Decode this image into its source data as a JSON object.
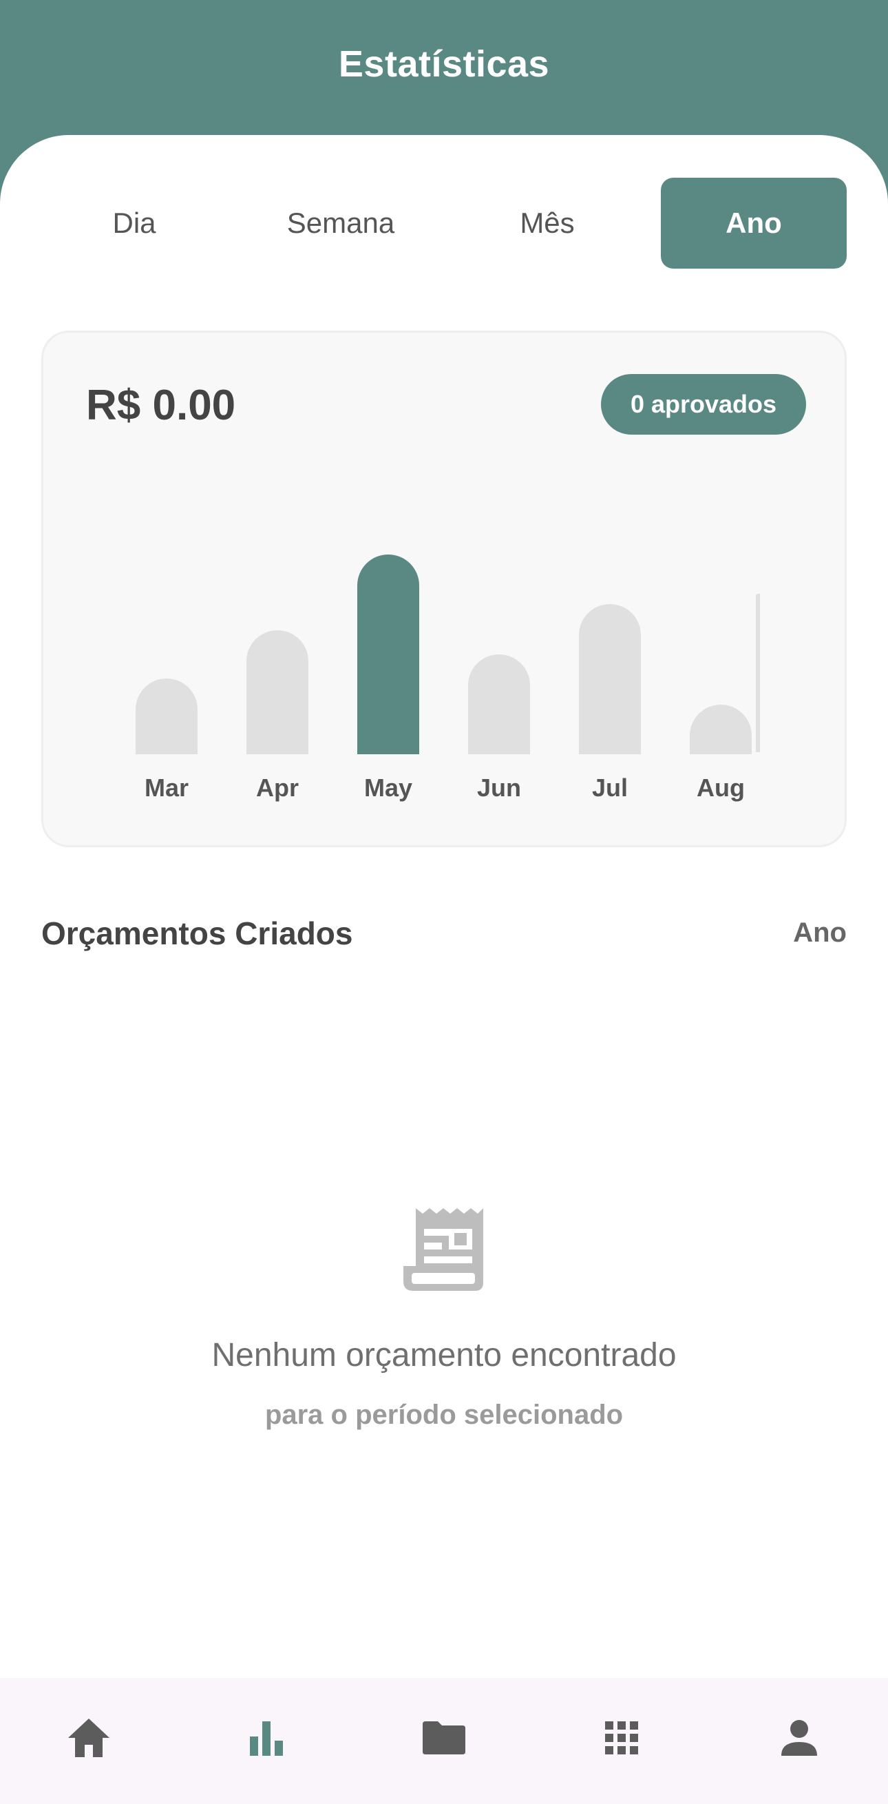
{
  "header": {
    "title": "Estatísticas"
  },
  "tabs": [
    {
      "label": "Dia",
      "active": false
    },
    {
      "label": "Semana",
      "active": false
    },
    {
      "label": "Mês",
      "active": false
    },
    {
      "label": "Ano",
      "active": true
    }
  ],
  "summary": {
    "amount": "R$ 0.00",
    "approved_badge": "0 aprovados"
  },
  "chart_data": {
    "type": "bar",
    "categories": [
      "Mar",
      "Apr",
      "May",
      "Jun",
      "Jul",
      "Aug"
    ],
    "values": [
      110,
      180,
      290,
      145,
      218,
      72
    ],
    "selected": "May",
    "colors": {
      "default": "#e0e0e0",
      "selected": "#5a8984"
    }
  },
  "section": {
    "title": "Orçamentos Criados",
    "filter": "Ano"
  },
  "empty_state": {
    "icon": "receipt-icon",
    "title": "Nenhum orçamento encontrado",
    "subtitle": "para o período selecionado"
  },
  "bottom_nav": [
    {
      "icon": "home-icon",
      "active": false
    },
    {
      "icon": "bar-chart-icon",
      "active": true
    },
    {
      "icon": "folder-icon",
      "active": false
    },
    {
      "icon": "apps-grid-icon",
      "active": false
    },
    {
      "icon": "person-icon",
      "active": false
    }
  ],
  "colors": {
    "primary": "#5a8984",
    "text_dark": "#444444",
    "muted": "#9a9a9a"
  }
}
